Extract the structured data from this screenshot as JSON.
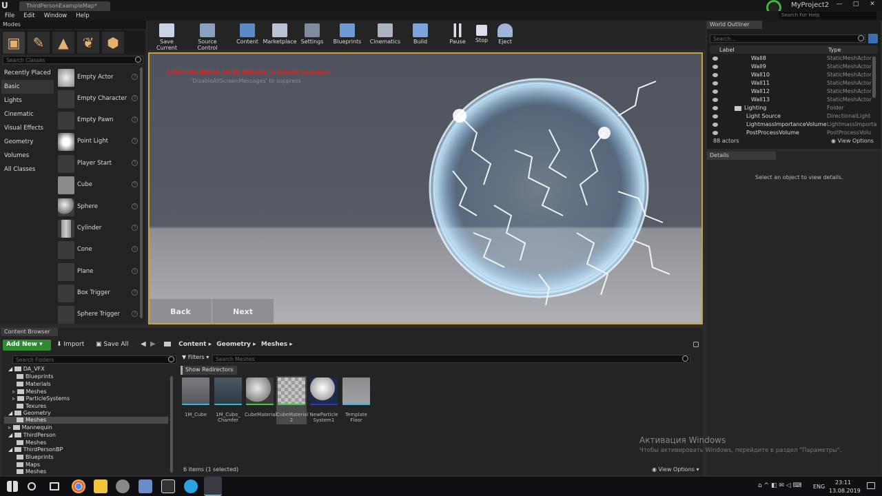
{
  "window": {
    "tab": "ThirdPersonExampleMap*",
    "project": "MyProject2",
    "search_help": "Search For Help"
  },
  "menu": [
    "File",
    "Edit",
    "Window",
    "Help"
  ],
  "modes": {
    "title": "Modes",
    "search_placeholder": "Search Classes",
    "categories": [
      "Recently Placed",
      "Basic",
      "Lights",
      "Cinematic",
      "Visual Effects",
      "Geometry",
      "Volumes",
      "All Classes"
    ],
    "items": [
      "Empty Actor",
      "Empty Character",
      "Empty Pawn",
      "Point Light",
      "Player Start",
      "Cube",
      "Sphere",
      "Cylinder",
      "Cone",
      "Plane",
      "Box Trigger",
      "Sphere Trigger"
    ]
  },
  "toolbar": [
    "Save Current",
    "Source Control",
    "Content",
    "Marketplace",
    "Settings",
    "Blueprints",
    "Cinematics",
    "Build",
    "Pause",
    "Stop",
    "Eject"
  ],
  "viewport": {
    "warning": "LIGHTING NEEDS TO BE REBUILT (3 unbuilt object(s))",
    "warning2": "'DisableAllScreenMessages' to suppress",
    "back": "Back",
    "next": "Next"
  },
  "outliner": {
    "title": "World Outliner",
    "search_placeholder": "Search...",
    "col_label": "Label",
    "col_type": "Type",
    "rows": [
      {
        "name": "Wall8",
        "type": "StaticMeshActor"
      },
      {
        "name": "Wall9",
        "type": "StaticMeshActor"
      },
      {
        "name": "Wall10",
        "type": "StaticMeshActor"
      },
      {
        "name": "Wall11",
        "type": "StaticMeshActor"
      },
      {
        "name": "Wall12",
        "type": "StaticMeshActor"
      },
      {
        "name": "Wall13",
        "type": "StaticMeshActor"
      },
      {
        "name": "Lighting",
        "type": "Folder"
      },
      {
        "name": "Light Source",
        "type": "DirectionalLight"
      },
      {
        "name": "LightmassImportanceVolume",
        "type": "LightmassImporta"
      },
      {
        "name": "PostProcessVolume",
        "type": "PostProcessVolu"
      }
    ],
    "count": "88 actors",
    "view_options": "View Options"
  },
  "details": {
    "title": "Details",
    "empty": "Select an object to view details."
  },
  "content_browser": {
    "title": "Content Browser",
    "add_new": "Add New",
    "import": "Import",
    "save_all": "Save All",
    "path": [
      "Content",
      "Geometry",
      "Meshes"
    ],
    "search_folders": "Search Folders",
    "filters": "Filters",
    "search_meshes": "Search Meshes",
    "show_redirectors": "Show Redirectors",
    "tree": [
      "DA_VFX",
      "Blueprints",
      "Materials",
      "Meshes",
      "ParticleSystems",
      "Texures",
      "Geometry",
      "Meshes",
      "Mannequin",
      "ThirdPerson",
      "Meshes",
      "ThirdPersonBP",
      "Blueprints",
      "Maps",
      "Meshes"
    ],
    "assets": [
      "1M_Cube",
      "1M_Cube_ Chamfer",
      "CubeMaterial",
      "CubeMaterial 2",
      "NewParticle System1",
      "Template Floor"
    ],
    "status": "6 items (1 selected)",
    "view_options": "View Options"
  },
  "activation": {
    "line1": "Активация Windows",
    "line2": "Чтобы активировать Windows, перейдите в раздел \"Параметры\"."
  },
  "taskbar": {
    "lang": "ENG",
    "time": "23:11",
    "date": "13.08.2019"
  }
}
